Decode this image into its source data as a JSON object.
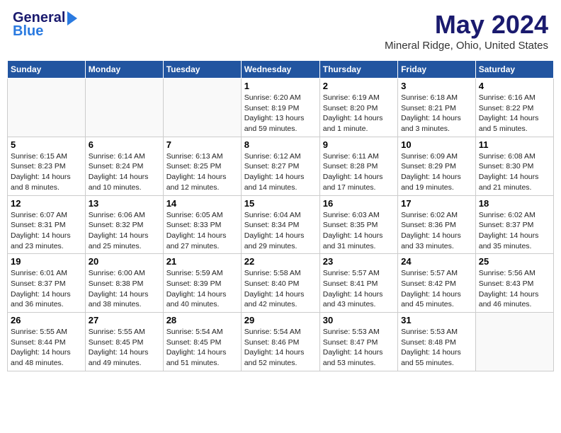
{
  "header": {
    "logo_general": "General",
    "logo_blue": "Blue",
    "month_title": "May 2024",
    "location": "Mineral Ridge, Ohio, United States"
  },
  "weekdays": [
    "Sunday",
    "Monday",
    "Tuesday",
    "Wednesday",
    "Thursday",
    "Friday",
    "Saturday"
  ],
  "weeks": [
    [
      {
        "day": "",
        "info": ""
      },
      {
        "day": "",
        "info": ""
      },
      {
        "day": "",
        "info": ""
      },
      {
        "day": "1",
        "info": "Sunrise: 6:20 AM\nSunset: 8:19 PM\nDaylight: 13 hours\nand 59 minutes."
      },
      {
        "day": "2",
        "info": "Sunrise: 6:19 AM\nSunset: 8:20 PM\nDaylight: 14 hours\nand 1 minute."
      },
      {
        "day": "3",
        "info": "Sunrise: 6:18 AM\nSunset: 8:21 PM\nDaylight: 14 hours\nand 3 minutes."
      },
      {
        "day": "4",
        "info": "Sunrise: 6:16 AM\nSunset: 8:22 PM\nDaylight: 14 hours\nand 5 minutes."
      }
    ],
    [
      {
        "day": "5",
        "info": "Sunrise: 6:15 AM\nSunset: 8:23 PM\nDaylight: 14 hours\nand 8 minutes."
      },
      {
        "day": "6",
        "info": "Sunrise: 6:14 AM\nSunset: 8:24 PM\nDaylight: 14 hours\nand 10 minutes."
      },
      {
        "day": "7",
        "info": "Sunrise: 6:13 AM\nSunset: 8:25 PM\nDaylight: 14 hours\nand 12 minutes."
      },
      {
        "day": "8",
        "info": "Sunrise: 6:12 AM\nSunset: 8:27 PM\nDaylight: 14 hours\nand 14 minutes."
      },
      {
        "day": "9",
        "info": "Sunrise: 6:11 AM\nSunset: 8:28 PM\nDaylight: 14 hours\nand 17 minutes."
      },
      {
        "day": "10",
        "info": "Sunrise: 6:09 AM\nSunset: 8:29 PM\nDaylight: 14 hours\nand 19 minutes."
      },
      {
        "day": "11",
        "info": "Sunrise: 6:08 AM\nSunset: 8:30 PM\nDaylight: 14 hours\nand 21 minutes."
      }
    ],
    [
      {
        "day": "12",
        "info": "Sunrise: 6:07 AM\nSunset: 8:31 PM\nDaylight: 14 hours\nand 23 minutes."
      },
      {
        "day": "13",
        "info": "Sunrise: 6:06 AM\nSunset: 8:32 PM\nDaylight: 14 hours\nand 25 minutes."
      },
      {
        "day": "14",
        "info": "Sunrise: 6:05 AM\nSunset: 8:33 PM\nDaylight: 14 hours\nand 27 minutes."
      },
      {
        "day": "15",
        "info": "Sunrise: 6:04 AM\nSunset: 8:34 PM\nDaylight: 14 hours\nand 29 minutes."
      },
      {
        "day": "16",
        "info": "Sunrise: 6:03 AM\nSunset: 8:35 PM\nDaylight: 14 hours\nand 31 minutes."
      },
      {
        "day": "17",
        "info": "Sunrise: 6:02 AM\nSunset: 8:36 PM\nDaylight: 14 hours\nand 33 minutes."
      },
      {
        "day": "18",
        "info": "Sunrise: 6:02 AM\nSunset: 8:37 PM\nDaylight: 14 hours\nand 35 minutes."
      }
    ],
    [
      {
        "day": "19",
        "info": "Sunrise: 6:01 AM\nSunset: 8:37 PM\nDaylight: 14 hours\nand 36 minutes."
      },
      {
        "day": "20",
        "info": "Sunrise: 6:00 AM\nSunset: 8:38 PM\nDaylight: 14 hours\nand 38 minutes."
      },
      {
        "day": "21",
        "info": "Sunrise: 5:59 AM\nSunset: 8:39 PM\nDaylight: 14 hours\nand 40 minutes."
      },
      {
        "day": "22",
        "info": "Sunrise: 5:58 AM\nSunset: 8:40 PM\nDaylight: 14 hours\nand 42 minutes."
      },
      {
        "day": "23",
        "info": "Sunrise: 5:57 AM\nSunset: 8:41 PM\nDaylight: 14 hours\nand 43 minutes."
      },
      {
        "day": "24",
        "info": "Sunrise: 5:57 AM\nSunset: 8:42 PM\nDaylight: 14 hours\nand 45 minutes."
      },
      {
        "day": "25",
        "info": "Sunrise: 5:56 AM\nSunset: 8:43 PM\nDaylight: 14 hours\nand 46 minutes."
      }
    ],
    [
      {
        "day": "26",
        "info": "Sunrise: 5:55 AM\nSunset: 8:44 PM\nDaylight: 14 hours\nand 48 minutes."
      },
      {
        "day": "27",
        "info": "Sunrise: 5:55 AM\nSunset: 8:45 PM\nDaylight: 14 hours\nand 49 minutes."
      },
      {
        "day": "28",
        "info": "Sunrise: 5:54 AM\nSunset: 8:45 PM\nDaylight: 14 hours\nand 51 minutes."
      },
      {
        "day": "29",
        "info": "Sunrise: 5:54 AM\nSunset: 8:46 PM\nDaylight: 14 hours\nand 52 minutes."
      },
      {
        "day": "30",
        "info": "Sunrise: 5:53 AM\nSunset: 8:47 PM\nDaylight: 14 hours\nand 53 minutes."
      },
      {
        "day": "31",
        "info": "Sunrise: 5:53 AM\nSunset: 8:48 PM\nDaylight: 14 hours\nand 55 minutes."
      },
      {
        "day": "",
        "info": ""
      }
    ]
  ]
}
